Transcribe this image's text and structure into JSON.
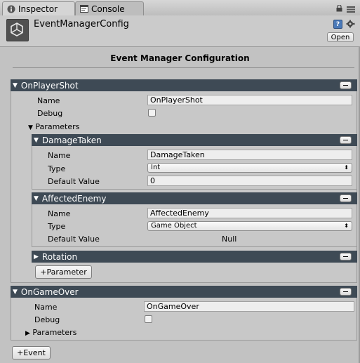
{
  "tabs": [
    {
      "label": "Inspector",
      "icon": "info-icon"
    },
    {
      "label": "Console",
      "icon": "console-icon"
    }
  ],
  "window_icons": [
    "lock-icon",
    "menu-icon"
  ],
  "asset": {
    "title": "EventManagerConfig",
    "open_label": "Open",
    "icons": [
      "help-icon",
      "gear-icon"
    ]
  },
  "config_title": "Event Manager Configuration",
  "events": [
    {
      "header": "OnPlayerShot",
      "name_label": "Name",
      "name_value": "OnPlayerShot",
      "debug_label": "Debug",
      "debug_checked": false,
      "parameters_label": "Parameters",
      "parameters_expanded": true,
      "parameters": [
        {
          "header": "DamageTaken",
          "expanded": true,
          "name_label": "Name",
          "name_value": "DamageTaken",
          "type_label": "Type",
          "type_value": "Int",
          "default_label": "Default Value",
          "default_value": "0"
        },
        {
          "header": "AffectedEnemy",
          "expanded": true,
          "name_label": "Name",
          "name_value": "AffectedEnemy",
          "type_label": "Type",
          "type_value": "Game Object",
          "default_label": "Default Value",
          "default_value": "Null"
        },
        {
          "header": "Rotation",
          "expanded": false
        }
      ],
      "add_parameter_label": "+Parameter"
    },
    {
      "header": "OnGameOver",
      "name_label": "Name",
      "name_value": "OnGameOver",
      "debug_label": "Debug",
      "debug_checked": false,
      "parameters_label": "Parameters",
      "parameters_expanded": false
    }
  ],
  "add_event_label": "+Event"
}
